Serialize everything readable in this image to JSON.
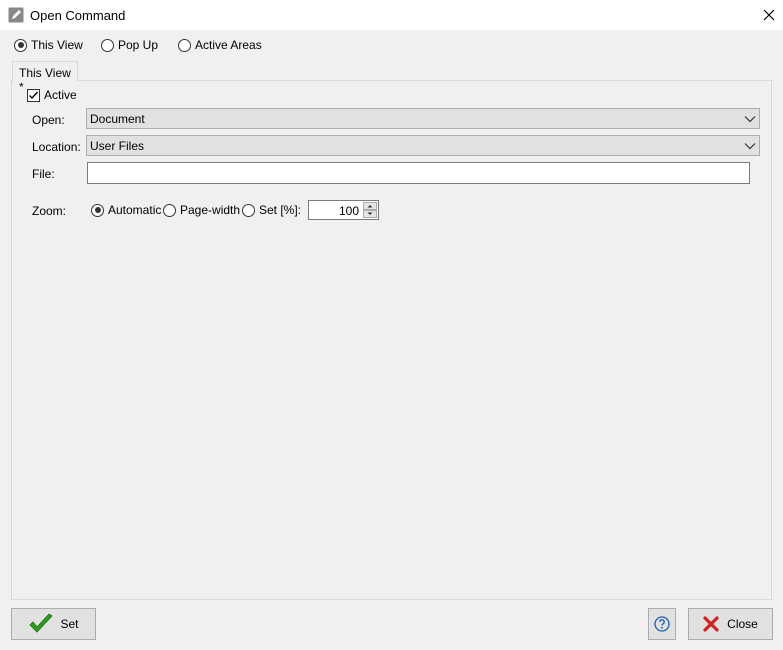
{
  "window": {
    "title": "Open Command",
    "title_icon": "pencil-icon",
    "close_icon": "close-icon"
  },
  "mode": {
    "options": [
      {
        "label": "This View",
        "checked": true
      },
      {
        "label": "Pop Up",
        "checked": false
      },
      {
        "label": "Active Areas",
        "checked": false
      }
    ]
  },
  "tab": {
    "label": "This View *"
  },
  "form": {
    "active_label": "Active",
    "active_checked": true,
    "open_label": "Open:",
    "open_value": "Document",
    "location_label": "Location:",
    "location_value": "User Files",
    "file_label": "File:",
    "file_value": "",
    "zoom_label": "Zoom:",
    "zoom_options": [
      {
        "label": "Automatic",
        "checked": true
      },
      {
        "label": "Page-width",
        "checked": false
      },
      {
        "label": "Set [%]:",
        "checked": false
      }
    ],
    "zoom_value": "100"
  },
  "footer": {
    "set_label": "Set",
    "set_icon": "checkmark-icon",
    "help_icon": "help-icon",
    "close_label": "Close",
    "close_icon": "red-x-icon"
  },
  "colors": {
    "check_green": "#2e9d1e",
    "close_red": "#d42020",
    "help_blue": "#1d5fb0"
  }
}
